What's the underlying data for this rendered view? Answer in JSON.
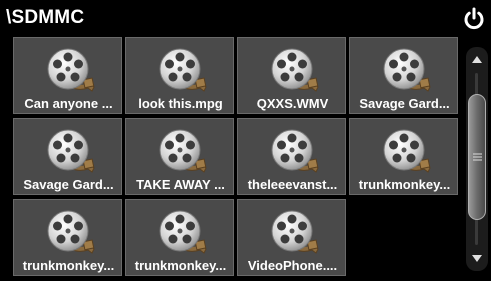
{
  "header": {
    "title": "\\SDMMC",
    "power_icon": "power-icon"
  },
  "files": [
    {
      "name": "Can anyone ...",
      "icon": "film-reel-icon"
    },
    {
      "name": "look this.mpg",
      "icon": "film-reel-icon"
    },
    {
      "name": "QXXS.WMV",
      "icon": "film-reel-icon"
    },
    {
      "name": "Savage Gard...",
      "icon": "film-reel-icon"
    },
    {
      "name": "Savage Gard...",
      "icon": "film-reel-icon"
    },
    {
      "name": "TAKE AWAY ...",
      "icon": "film-reel-icon"
    },
    {
      "name": "theleeevanst...",
      "icon": "film-reel-icon"
    },
    {
      "name": "trunkmonkey...",
      "icon": "film-reel-icon"
    },
    {
      "name": "trunkmonkey...",
      "icon": "film-reel-icon"
    },
    {
      "name": "trunkmonkey...",
      "icon": "film-reel-icon"
    },
    {
      "name": "VideoPhone....",
      "icon": "film-reel-icon"
    }
  ],
  "scrollbar": {
    "up_icon": "arrow-up-icon",
    "down_icon": "arrow-down-icon",
    "position": 0.45
  },
  "colors": {
    "background": "#000000",
    "tile": "#4a4a4a",
    "text": "#ffffff"
  }
}
